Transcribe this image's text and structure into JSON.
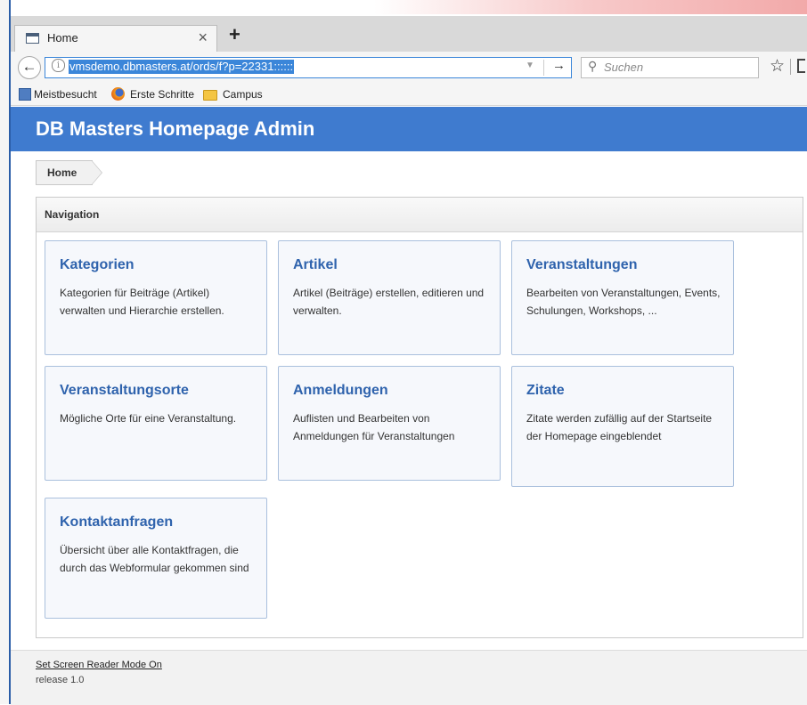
{
  "browser": {
    "tab_title": "Home",
    "tab_close": "×",
    "new_tab": "+",
    "url": "vmsdemo.dbmasters.at/ords/f?p=22331::::::",
    "search_placeholder": "Suchen",
    "bookmarks": [
      "Meistbesucht",
      "Erste Schritte",
      "Campus"
    ]
  },
  "app": {
    "title": "DB Masters Homepage Admin"
  },
  "breadcrumb": {
    "home": "Home"
  },
  "region": {
    "title": "Navigation",
    "cards": [
      {
        "title": "Kategorien",
        "desc": "Kategorien für Beiträge (Artikel) verwalten und Hierarchie erstellen."
      },
      {
        "title": "Artikel",
        "desc": "Artikel (Beiträge) erstellen, editieren und verwalten."
      },
      {
        "title": "Veranstaltungen",
        "desc": "Bearbeiten von Veranstaltungen, Events, Schulungen, Workshops, ..."
      },
      {
        "title": "Veranstaltungsorte",
        "desc": "Mögliche Orte für eine Veranstaltung."
      },
      {
        "title": "Anmeldungen",
        "desc": "Auflisten und Bearbeiten von Anmeldungen für Veranstaltungen"
      },
      {
        "title": "Zitate",
        "desc": "Zitate werden zufällig auf der Startseite der Homepage eingeblendet"
      },
      {
        "title": "Kontaktanfragen",
        "desc": "Übersicht über alle Kontaktfragen, die durch das Webformular gekommen sind"
      }
    ]
  },
  "footer": {
    "screen_reader_link": "Set Screen Reader Mode On",
    "release": "release 1.0"
  }
}
